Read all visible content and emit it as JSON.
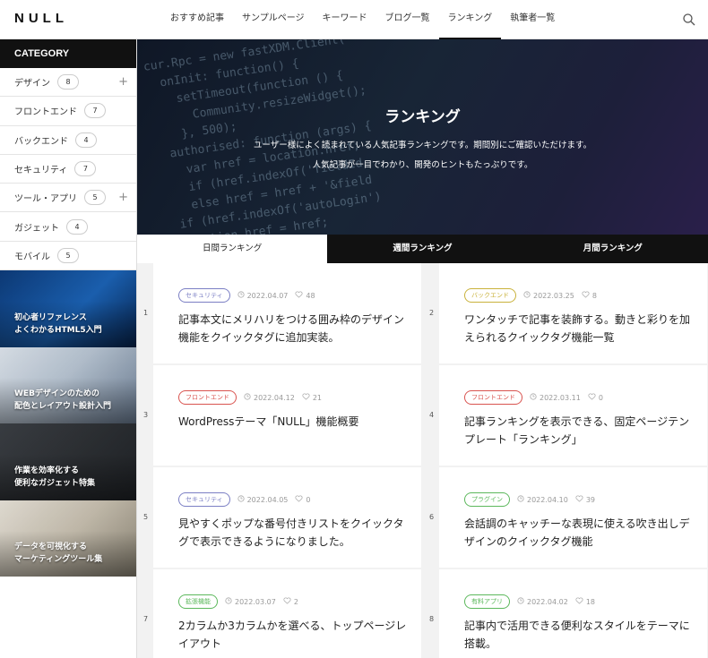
{
  "header": {
    "logo": "NULL",
    "nav": [
      {
        "label": "おすすめ記事"
      },
      {
        "label": "サンプルページ"
      },
      {
        "label": "キーワード"
      },
      {
        "label": "ブログ一覧"
      },
      {
        "label": "ランキング",
        "active": true
      },
      {
        "label": "執筆者一覧"
      }
    ],
    "search_icon": "search-icon"
  },
  "sidebar": {
    "title": "CATEGORY",
    "categories": [
      {
        "label": "デザイン",
        "count": "8",
        "expandable": true
      },
      {
        "label": "フロントエンド",
        "count": "7",
        "expandable": false
      },
      {
        "label": "バックエンド",
        "count": "4",
        "expandable": false
      },
      {
        "label": "セキュリティ",
        "count": "7",
        "expandable": false
      },
      {
        "label": "ツール・アプリ",
        "count": "5",
        "expandable": true
      },
      {
        "label": "ガジェット",
        "count": "4",
        "expandable": false
      },
      {
        "label": "モバイル",
        "count": "5",
        "expandable": false
      }
    ],
    "banners": [
      {
        "line1": "初心者リファレンス",
        "line2": "よくわかるHTML5入門"
      },
      {
        "line1": "WEBデザインのための",
        "line2": "配色とレイアウト設計入門"
      },
      {
        "line1": "作業を効率化する",
        "line2": "便利なガジェット特集"
      },
      {
        "line1": "データを可視化する",
        "line2": "マーケティングツール集"
      }
    ]
  },
  "hero": {
    "title": "ランキング",
    "desc_line1": "ユーザー様によく読まれている人気記事ランキングです。期間別にご確認いただけます。",
    "desc_line2": "人気記事が一目でわかり、開発のヒントもたっぷりです。"
  },
  "tabs": [
    {
      "label": "日間ランキング",
      "active": true
    },
    {
      "label": "週間ランキング",
      "active": false
    },
    {
      "label": "月間ランキング",
      "active": false
    }
  ],
  "ranking": [
    {
      "rank": "1",
      "tag": "セキュリティ",
      "tag_color": "#7b7fc4",
      "date": "2022.04.07",
      "likes": "48",
      "title": "記事本文にメリハリをつける囲み枠のデザイン機能をクイックタグに追加実装。"
    },
    {
      "rank": "2",
      "tag": "バックエンド",
      "tag_color": "#c9b23b",
      "date": "2022.03.25",
      "likes": "8",
      "title": "ワンタッチで記事を装飾する。動きと彩りを加えられるクイックタグ機能一覧"
    },
    {
      "rank": "3",
      "tag": "フロントエンド",
      "tag_color": "#d9534f",
      "date": "2022.04.12",
      "likes": "21",
      "title": "WordPressテーマ「NULL」機能概要"
    },
    {
      "rank": "4",
      "tag": "フロントエンド",
      "tag_color": "#d9534f",
      "date": "2022.03.11",
      "likes": "0",
      "title": "記事ランキングを表示できる、固定ページテンプレート「ランキング」"
    },
    {
      "rank": "5",
      "tag": "セキュリティ",
      "tag_color": "#7b7fc4",
      "date": "2022.04.05",
      "likes": "0",
      "title": "見やすくポップな番号付きリストをクイックタグで表示できるようになりました。"
    },
    {
      "rank": "6",
      "tag": "プラグイン",
      "tag_color": "#5cb85c",
      "date": "2022.04.10",
      "likes": "39",
      "title": "会話調のキャッチーな表現に使える吹き出しデザインのクイックタグ機能"
    },
    {
      "rank": "7",
      "tag": "拡張機能",
      "tag_color": "#5cb85c",
      "date": "2022.03.07",
      "likes": "2",
      "title": "2カラムか3カラムかを選べる、トップページレイアウト"
    },
    {
      "rank": "8",
      "tag": "有料アプリ",
      "tag_color": "#5cb85c",
      "date": "2022.04.02",
      "likes": "18",
      "title": "記事内で活用できる便利なスタイルをテーマに搭載。"
    }
  ]
}
